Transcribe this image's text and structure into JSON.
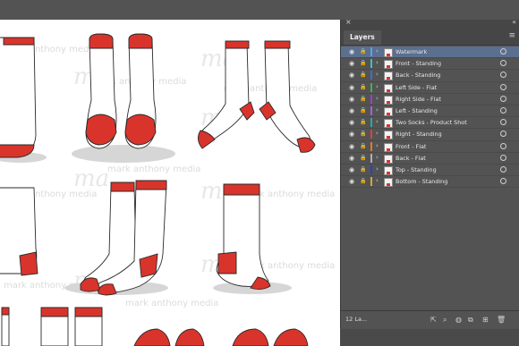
{
  "panel": {
    "close": "×",
    "collapse": "«",
    "tab": "Layers",
    "menu": "≡"
  },
  "watermark": "mark anthony media",
  "colors": {
    "sock": "#ffffff",
    "accent": "#d9342b",
    "outline": "#2a2a2a",
    "selection": "#5b6f8f"
  },
  "layers": [
    {
      "name": "Watermark",
      "color": "#5da1e6",
      "selected": true,
      "eye": "◉",
      "lock": "🔒",
      "chev": "›"
    },
    {
      "name": "Front - Standing",
      "color": "#2ec7c7",
      "eye": "◉",
      "lock": "🔒",
      "chev": "›"
    },
    {
      "name": "Back - Standing",
      "color": "#3f6bd9",
      "eye": "◉",
      "lock": "🔒",
      "chev": "›"
    },
    {
      "name": "Left Side - Flat",
      "color": "#3fb34f",
      "eye": "◉",
      "lock": "🔒",
      "chev": "›"
    },
    {
      "name": "Right Side - Flat",
      "color": "#9b3fd1",
      "eye": "◉",
      "lock": "🔒",
      "chev": "›"
    },
    {
      "name": "Left - Standing",
      "color": "#a95de0",
      "eye": "◉",
      "lock": "🔒",
      "chev": "›"
    },
    {
      "name": "Two Socks - Product Shot",
      "color": "#2fa6a6",
      "eye": "◉",
      "lock": "🔒",
      "chev": "›"
    },
    {
      "name": "Right - Standing",
      "color": "#d94141",
      "eye": "◉",
      "lock": "🔒",
      "chev": "›"
    },
    {
      "name": "Front - Flat",
      "color": "#e07a2e",
      "eye": "◉",
      "lock": "🔒",
      "chev": "›"
    },
    {
      "name": "Back - Flat",
      "color": "#b0b0b0",
      "eye": "◉",
      "lock": "🔒",
      "chev": "›"
    },
    {
      "name": "Top - Standing",
      "color": "#2b3fcc",
      "eye": "◉",
      "lock": "🔒",
      "chev": "›"
    },
    {
      "name": "Bottom - Standing",
      "color": "#e0a52e",
      "eye": "◉",
      "lock": "🔒",
      "chev": "›"
    }
  ],
  "footer": {
    "count": "12 La...",
    "icons": [
      {
        "name": "export-icon",
        "glyph": "⇱"
      },
      {
        "name": "find-layer-icon",
        "glyph": "⌕"
      },
      {
        "name": "make-clipping-mask-icon",
        "glyph": "◍"
      },
      {
        "name": "new-sublayer-icon",
        "glyph": "⧉"
      },
      {
        "name": "new-layer-icon",
        "glyph": "⊞"
      },
      {
        "name": "delete-layer-icon",
        "glyph": "🗑"
      }
    ]
  }
}
